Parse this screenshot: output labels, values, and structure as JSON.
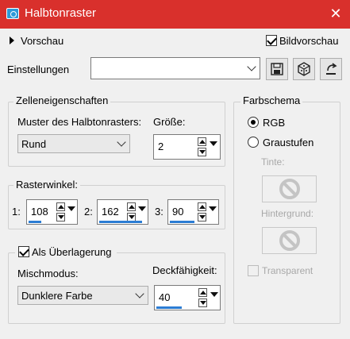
{
  "window": {
    "title": "Halbtonraster",
    "close_glyph": "✕"
  },
  "preview": {
    "toggle_label": "Vorschau",
    "image_preview_label": "Bildvorschau",
    "image_preview_checked": true
  },
  "settings": {
    "label": "Einstellungen",
    "value": ""
  },
  "cell_props": {
    "title": "Zelleneigenschaften",
    "pattern_label": "Muster des Halbtonrasters:",
    "pattern_value": "Rund",
    "size_label": "Größe:",
    "size_value": "2"
  },
  "angles": {
    "title": "Rasterwinkel:",
    "items": [
      {
        "label": "1:",
        "value": "108",
        "bar_fraction": 0.3
      },
      {
        "label": "2:",
        "value": "162",
        "bar_fraction": 0.45
      },
      {
        "label": "3:",
        "value": "90",
        "bar_fraction": 0.25
      }
    ]
  },
  "overlay": {
    "checkbox_label": "Als Überlagerung",
    "checked": true,
    "blend_label": "Mischmodus:",
    "blend_value": "Dunklere Farbe",
    "opacity_label": "Deckfähigkeit:",
    "opacity_value": "40",
    "opacity_fraction": 0.4
  },
  "color_scheme": {
    "title": "Farbschema",
    "rgb_label": "RGB",
    "gray_label": "Graustufen",
    "selected": "RGB",
    "tint_label": "Tinte:",
    "background_label": "Hintergrund:",
    "transparent_label": "Transparent"
  },
  "colors": {
    "titlebar": "#d9302c",
    "accent": "#2b7cd3"
  }
}
